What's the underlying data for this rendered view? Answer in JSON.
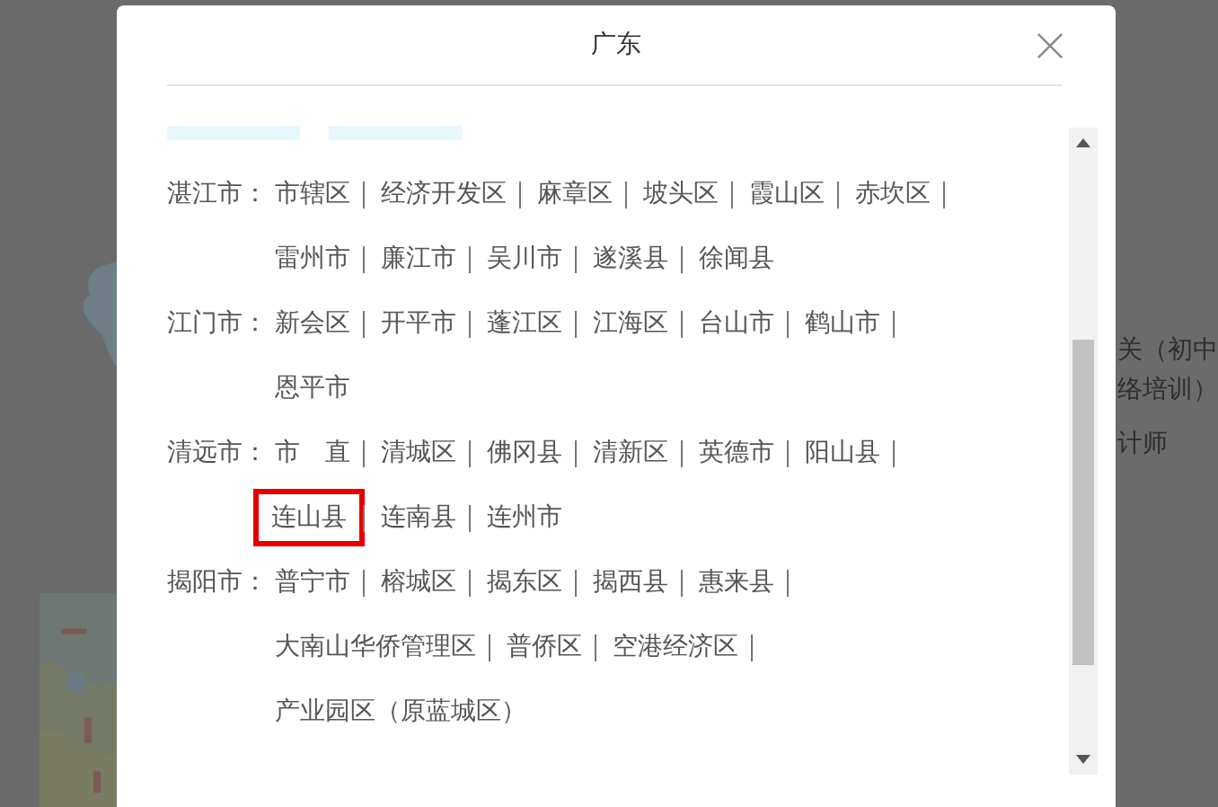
{
  "dialog": {
    "title": "广东",
    "cities": [
      {
        "name": "湛江市：",
        "districts": [
          {
            "name": "市辖区",
            "selected": false
          },
          {
            "name": "经济开发区",
            "selected": false
          },
          {
            "name": "麻章区",
            "selected": false
          },
          {
            "name": "坡头区",
            "selected": false
          },
          {
            "name": "霞山区",
            "selected": false
          },
          {
            "name": "赤坎区",
            "selected": false
          },
          {
            "name": "雷州市",
            "selected": false
          },
          {
            "name": "廉江市",
            "selected": false
          },
          {
            "name": "吴川市",
            "selected": false
          },
          {
            "name": "遂溪县",
            "selected": false
          },
          {
            "name": "徐闻县",
            "selected": false
          }
        ]
      },
      {
        "name": "江门市：",
        "districts": [
          {
            "name": "新会区",
            "selected": false
          },
          {
            "name": "开平市",
            "selected": false
          },
          {
            "name": "蓬江区",
            "selected": false
          },
          {
            "name": "江海区",
            "selected": false
          },
          {
            "name": "台山市",
            "selected": false
          },
          {
            "name": "鹤山市",
            "selected": false
          },
          {
            "name": "恩平市",
            "selected": false
          }
        ]
      },
      {
        "name": "清远市：",
        "districts": [
          {
            "name": "市　直",
            "selected": false
          },
          {
            "name": "清城区",
            "selected": false
          },
          {
            "name": "佛冈县",
            "selected": false
          },
          {
            "name": "清新区",
            "selected": false
          },
          {
            "name": "英德市",
            "selected": false
          },
          {
            "name": "阳山县",
            "selected": false
          },
          {
            "name": "连山县",
            "selected": true
          },
          {
            "name": "连南县",
            "selected": false
          },
          {
            "name": "连州市",
            "selected": false
          }
        ]
      },
      {
        "name": "揭阳市：",
        "districts": [
          {
            "name": "普宁市",
            "selected": false
          },
          {
            "name": "榕城区",
            "selected": false
          },
          {
            "name": "揭东区",
            "selected": false
          },
          {
            "name": "揭西县",
            "selected": false
          },
          {
            "name": "惠来县",
            "selected": false
          },
          {
            "name": "大南山华侨管理区",
            "selected": false
          },
          {
            "name": "普侨区",
            "selected": false
          },
          {
            "name": "空港经济区",
            "selected": false
          },
          {
            "name": "产业园区（原蓝城区）",
            "selected": false
          }
        ]
      }
    ]
  },
  "background": {
    "texts": [
      "关（初中",
      "络培训）",
      "计师"
    ]
  }
}
